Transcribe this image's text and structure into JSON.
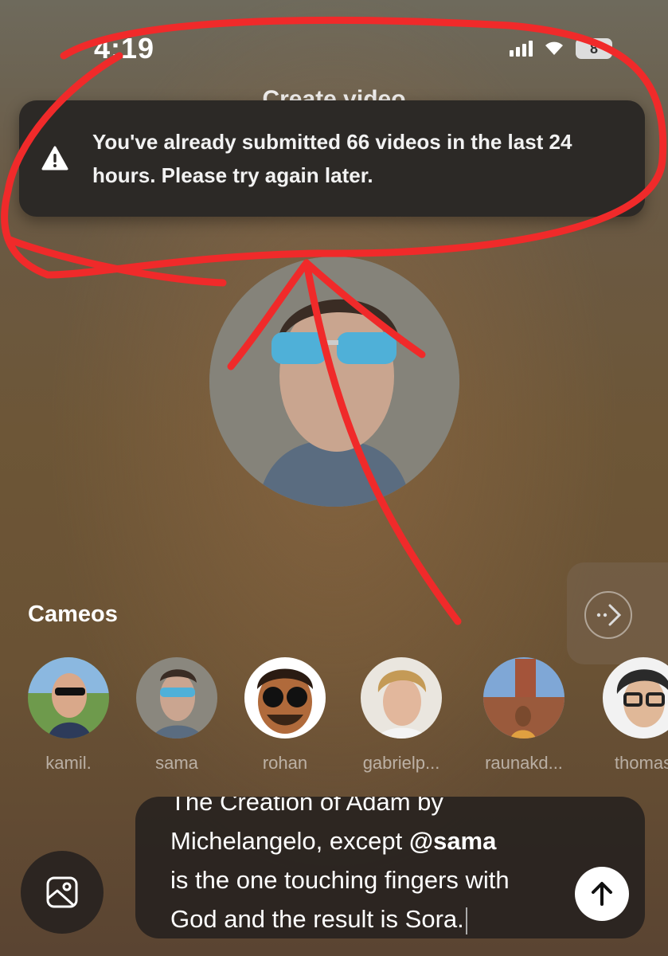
{
  "status_bar": {
    "time": "4:19",
    "battery": "8"
  },
  "header": {
    "title": "Create video"
  },
  "toast": {
    "icon": "warning-icon",
    "message": "You've already submitted 66 videos in the last 24 hours. Please try again later."
  },
  "cameos": {
    "title": "Cameos",
    "items": [
      {
        "name": "kamil."
      },
      {
        "name": "sama"
      },
      {
        "name": "rohan"
      },
      {
        "name": "gabrielp..."
      },
      {
        "name": "raunakd..."
      },
      {
        "name": "thomas"
      }
    ]
  },
  "prompt": {
    "line1": "The Creation of Adam by",
    "line2_pre": "Michelangelo, except ",
    "mention": "@sama",
    "line3": "is the one touching fingers with",
    "line4": "God and the result is Sora."
  },
  "colors": {
    "annotation": "#f02a2a",
    "toast_bg": "#2c2926"
  }
}
